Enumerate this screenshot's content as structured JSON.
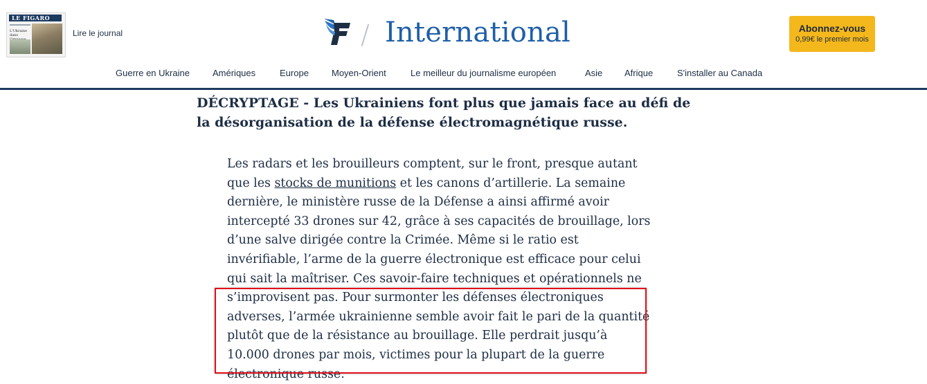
{
  "header": {
    "journal_cta": "Lire le journal",
    "journal_masthead": "LE FIGARO",
    "journal_headline": "L'Ukraine dans l'impasse mais riche de contre-offensive",
    "section": "International",
    "separator": "/",
    "subscribe": {
      "label": "Abonnez-vous",
      "price": "0,99€ le premier mois"
    },
    "brand_color": "#1f5fa8",
    "cta_color": "#f4b81c"
  },
  "nav": {
    "items": [
      "Guerre en Ukraine",
      "Amériques",
      "Europe",
      "Moyen-Orient",
      "Le meilleur du journalisme européen",
      "Asie",
      "Afrique",
      "S'installer au Canada"
    ]
  },
  "article": {
    "title": "DÉCRYPTAGE - Les Ukrainiens font plus que jamais face au défi de la désorganisation de la défense électromagnétique russe.",
    "body_before_link": "Les radars et les brouilleurs comptent, sur le front, presque autant que les ",
    "link_text": "stocks de munitions",
    "body_after_link": " et les canons d’artillerie. La semaine dernière, le ministère russe de la Défense a ainsi affirmé avoir intercepté 33 drones sur 42, grâce à ses capacités de brouillage, lors d’une salve dirigée contre la Crimée. Même si le ratio est invérifiable, l’arme de la guerre électronique est efficace pour celui qui sait la maîtriser. Ces savoir-faire techniques et opérationnels ne s’improvisent pas. Pour surmonter les défenses électroniques adverses, l’armée ukrainienne semble avoir fait le pari de la quantité plutôt que de la résistance au brouillage. Elle perdrait jusqu’à 10.000 drones par mois, victimes pour la plupart de la guerre électronique russe.",
    "highlight_color": "#e0101a"
  }
}
